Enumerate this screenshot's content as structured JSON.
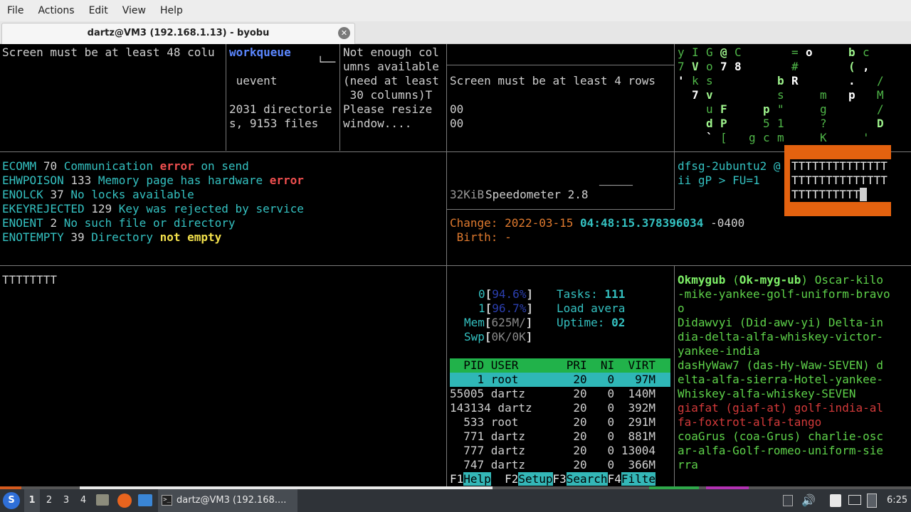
{
  "menu": [
    "File",
    "Actions",
    "Edit",
    "View",
    "Help"
  ],
  "tab": {
    "title": "dartz@VM3 (192.168.1.13) - byobu",
    "close": "✕"
  },
  "pane1": {
    "line1": "Screen must be at least 48 colu"
  },
  "pane2": {
    "workqueue": "workqueue",
    "corner": "└──",
    "uevent": " uevent",
    "dirs1": "2031 directorie",
    "dirs2": "s, 9153 files"
  },
  "pane3": {
    "l1": "Not enough col",
    "l2": "umns available",
    "l3": "(need at least",
    "l4": " 30 columns)T",
    "l5": "Please resize",
    "l6": "window...."
  },
  "pane4": {
    "l1": "Screen must be at least 4 rows",
    "l2": "00",
    "l3": "00"
  },
  "errors": [
    {
      "name": "ECOMM",
      "num": "70",
      "pre": "Communication ",
      "hi": "error",
      "post": " on send",
      "hi_class": "c-red"
    },
    {
      "name": "EHWPOISON",
      "num": "133",
      "pre": "Memory page has hardware ",
      "hi": "error",
      "post": "",
      "hi_class": "c-red"
    },
    {
      "name": "ENOLCK",
      "num": "37",
      "pre": "No locks available",
      "hi": "",
      "post": "",
      "hi_class": ""
    },
    {
      "name": "EKEYREJECTED",
      "num": "129",
      "pre": "Key was rejected by service",
      "hi": "",
      "post": "",
      "hi_class": ""
    },
    {
      "name": "ENOENT",
      "num": "2",
      "pre": "No such file or directory",
      "hi": "",
      "post": "",
      "hi_class": ""
    },
    {
      "name": "ENOTEMPTY",
      "num": "39",
      "pre": "Directory ",
      "hi": "not empty",
      "post": "",
      "hi_class": "c-yellow"
    }
  ],
  "speedometer": {
    "size": "32KiB",
    "label": "Speedometer 2.8",
    "line": "──────"
  },
  "dfsg": {
    "l1": "dfsg-2ubuntu2 @",
    "l2": "ii gP > FU=1"
  },
  "tbox": {
    "l1": "TTTTTTTTTTTTTT",
    "l2": "TTTTTTTTTTTTTT",
    "l3": "TTTTTTTTTT"
  },
  "stat": {
    "change_label": "Change:",
    "date": "2022-03-15",
    "time": "04:48:15.378396034",
    "tz": "-0400",
    "birth_label": " Birth:",
    "birth_val": "-"
  },
  "ttext": "TTTTTTTT",
  "htop": {
    "cpu0": {
      "num": "0",
      "val": "94.6%"
    },
    "cpu1": {
      "num": "1",
      "val": "96.7%"
    },
    "mem": {
      "label": "Mem",
      "val": "625M/"
    },
    "swp": {
      "label": "Swp",
      "val": "0K/0K"
    },
    "tasks_label": "Tasks:",
    "tasks_val": "111",
    "load_label": "Load avera",
    "uptime_label": "Uptime:",
    "uptime_val": "02",
    "header": "  PID USER       PRI  NI  VIRT",
    "rows": [
      "    1 root        20   0   97M",
      "55005 dartz       20   0  140M",
      "143134 dartz      20   0  392M",
      "  533 root        20   0  291M",
      "  771 dartz       20   0  881M",
      "  777 dartz       20   0 13004",
      "  747 dartz       20   0  366M"
    ],
    "fkeys": [
      {
        "k": "F1",
        "l": "Help"
      },
      {
        "k": "F2",
        "l": "Setup"
      },
      {
        "k": "F3",
        "l": "Search"
      },
      {
        "k": "F4",
        "l": "Filte"
      }
    ]
  },
  "words": [
    {
      "a": "Okmygub",
      "b": "(Ok-myg-ub)",
      "c": " Oscar-kilo",
      "cls": "c-bgreen"
    },
    {
      "line": "-mike-yankee-golf-uniform-bra",
      "tail": "vo"
    },
    {
      "line": "o"
    },
    {
      "line": "Didawvyi (Did-awv-yi) Delta-in"
    },
    {
      "line": "dia-delta-alfa-whiskey-victor-"
    },
    {
      "line": "yankee-india"
    },
    {
      "line": "dasHyWaw7 (das-Hy-Waw-SEVEN) d"
    },
    {
      "line": "elta-alfa-sierra-Hotel-yankee-"
    },
    {
      "line": "Whiskey-alfa-whiskey-SEVEN"
    },
    {
      "line": "giafat (giaf-at) golf-india-al"
    },
    {
      "line": "fa-foxtrot-alfa-tango"
    },
    {
      "line": "coaGrus (coa-Grus) charlie-osc"
    },
    {
      "line": "ar-alfa-Golf-romeo-uniform-sie"
    },
    {
      "line": "rra"
    }
  ],
  "taskbar": {
    "workspaces": [
      "1",
      "2",
      "3",
      "4"
    ],
    "window_title": "dartz@VM3 (192.168....",
    "clock": "6:25"
  }
}
